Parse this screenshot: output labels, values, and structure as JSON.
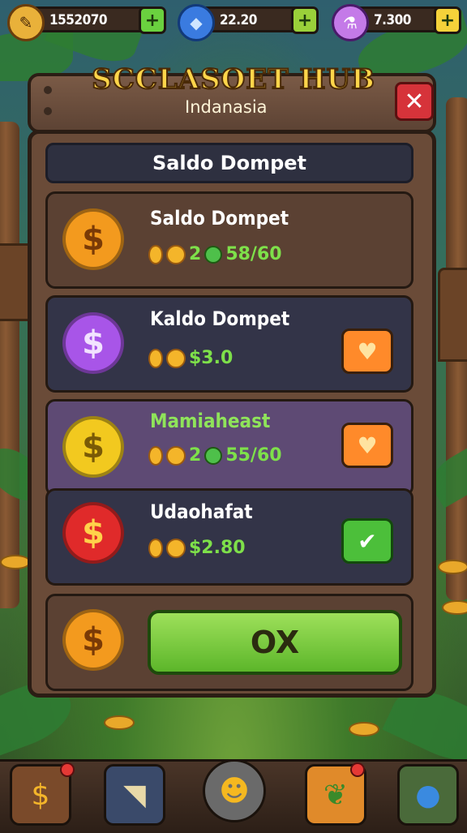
{
  "hud": {
    "coins": {
      "value": "1552070",
      "icon": "coin-scroll-icon"
    },
    "gems": {
      "value": "22.20",
      "icon": "blue-gem-icon"
    },
    "potion": {
      "value": "7.300",
      "icon": "potion-icon"
    },
    "plus_glyph": "+"
  },
  "panel": {
    "title": "SCCLASOET HUB",
    "subtitle": "Indanasia",
    "close_glyph": "✕",
    "header": "Saldo Dompet"
  },
  "rows": [
    {
      "name": "Saldo Dompet",
      "stat_prefix": "2",
      "stat_value": "58/60",
      "coin_color": "#f39a1e",
      "coin_glyph": "$"
    },
    {
      "name": "Kaldo Dompet",
      "stat_value": "$3.0",
      "coin_color": "#a855e8",
      "coin_glyph": "$",
      "action": "heart",
      "action_glyph": "♥"
    },
    {
      "name": "Mamiaheast",
      "stat_prefix": "2",
      "stat_value": "55/60",
      "coin_color": "#f2c91f",
      "coin_glyph": "$",
      "action": "heart",
      "action_glyph": "♥"
    },
    {
      "name": "Udaohafat",
      "stat_value": "$2.80",
      "coin_color": "#e02a2a",
      "coin_glyph": "$",
      "action": "check",
      "action_glyph": "✔"
    }
  ],
  "footer": {
    "ok_label": "OX",
    "coin_glyph": "$"
  },
  "dock": {
    "items": [
      "coin-bag-icon",
      "cannon-icon",
      "mascot-icon",
      "leaf-shield-icon",
      "blue-orb-icon"
    ],
    "glyphs": [
      "$",
      "◥",
      "☻",
      "❦",
      "●"
    ]
  },
  "colors": {
    "accent_green": "#5cb62a",
    "close_red": "#d6333a",
    "heart_orange": "#ff8a2a"
  }
}
